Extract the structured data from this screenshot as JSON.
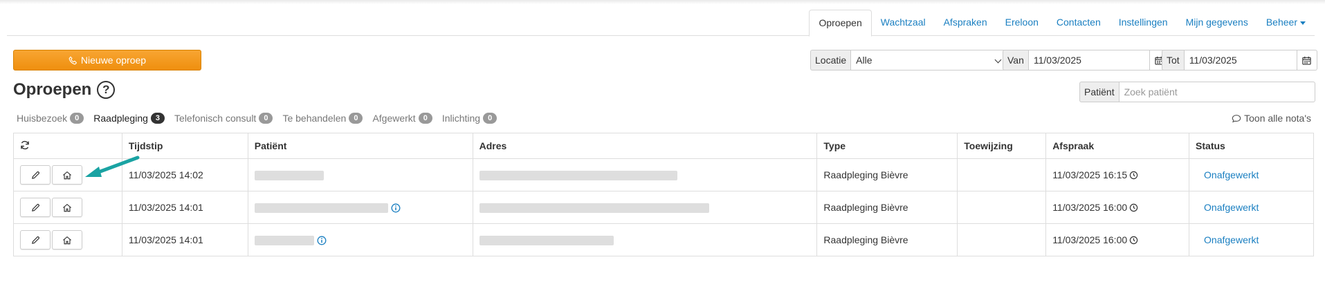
{
  "nav": {
    "tabs": [
      "Oproepen",
      "Wachtzaal",
      "Afspraken",
      "Ereloon",
      "Contacten",
      "Instellingen",
      "Mijn gegevens",
      "Beheer"
    ],
    "active": "Oproepen"
  },
  "toolbar": {
    "new_call_label": "Nieuwe oproep",
    "locatie_label": "Locatie",
    "locatie_value": "Alle",
    "van_label": "Van",
    "van_value": "11/03/2025",
    "tot_label": "Tot",
    "tot_value": "11/03/2025",
    "patient_label": "Patiënt",
    "patient_placeholder": "Zoek patiënt"
  },
  "page": {
    "title": "Oproepen",
    "help": "?"
  },
  "filters": [
    {
      "label": "Huisbezoek",
      "count": "0"
    },
    {
      "label": "Raadpleging",
      "count": "3"
    },
    {
      "label": "Telefonisch consult",
      "count": "0"
    },
    {
      "label": "Te behandelen",
      "count": "0"
    },
    {
      "label": "Afgewerkt",
      "count": "0"
    },
    {
      "label": "Inlichting",
      "count": "0"
    }
  ],
  "active_filter": "Raadpleging",
  "notes_link": "Toon alle nota's",
  "table": {
    "columns": [
      "",
      "Tijdstip",
      "Patiënt",
      "Adres",
      "Type",
      "Toewijzing",
      "Afspraak",
      "Status"
    ],
    "rows": [
      {
        "tijdstip": "11/03/2025 14:02",
        "type": "Raadpleging Bièvre",
        "toewijzing": "",
        "afspraak": "11/03/2025 16:15",
        "status": "Onafgewerkt"
      },
      {
        "tijdstip": "11/03/2025 14:01",
        "type": "Raadpleging Bièvre",
        "toewijzing": "",
        "afspraak": "11/03/2025 16:00",
        "status": "Onafgewerkt"
      },
      {
        "tijdstip": "11/03/2025 14:01",
        "type": "Raadpleging Bièvre",
        "toewijzing": "",
        "afspraak": "11/03/2025 16:00",
        "status": "Onafgewerkt"
      }
    ]
  },
  "colors": {
    "link": "#1a7fc1",
    "orange": "#f39a1f",
    "annotation_arrow": "#1aa3a3"
  }
}
